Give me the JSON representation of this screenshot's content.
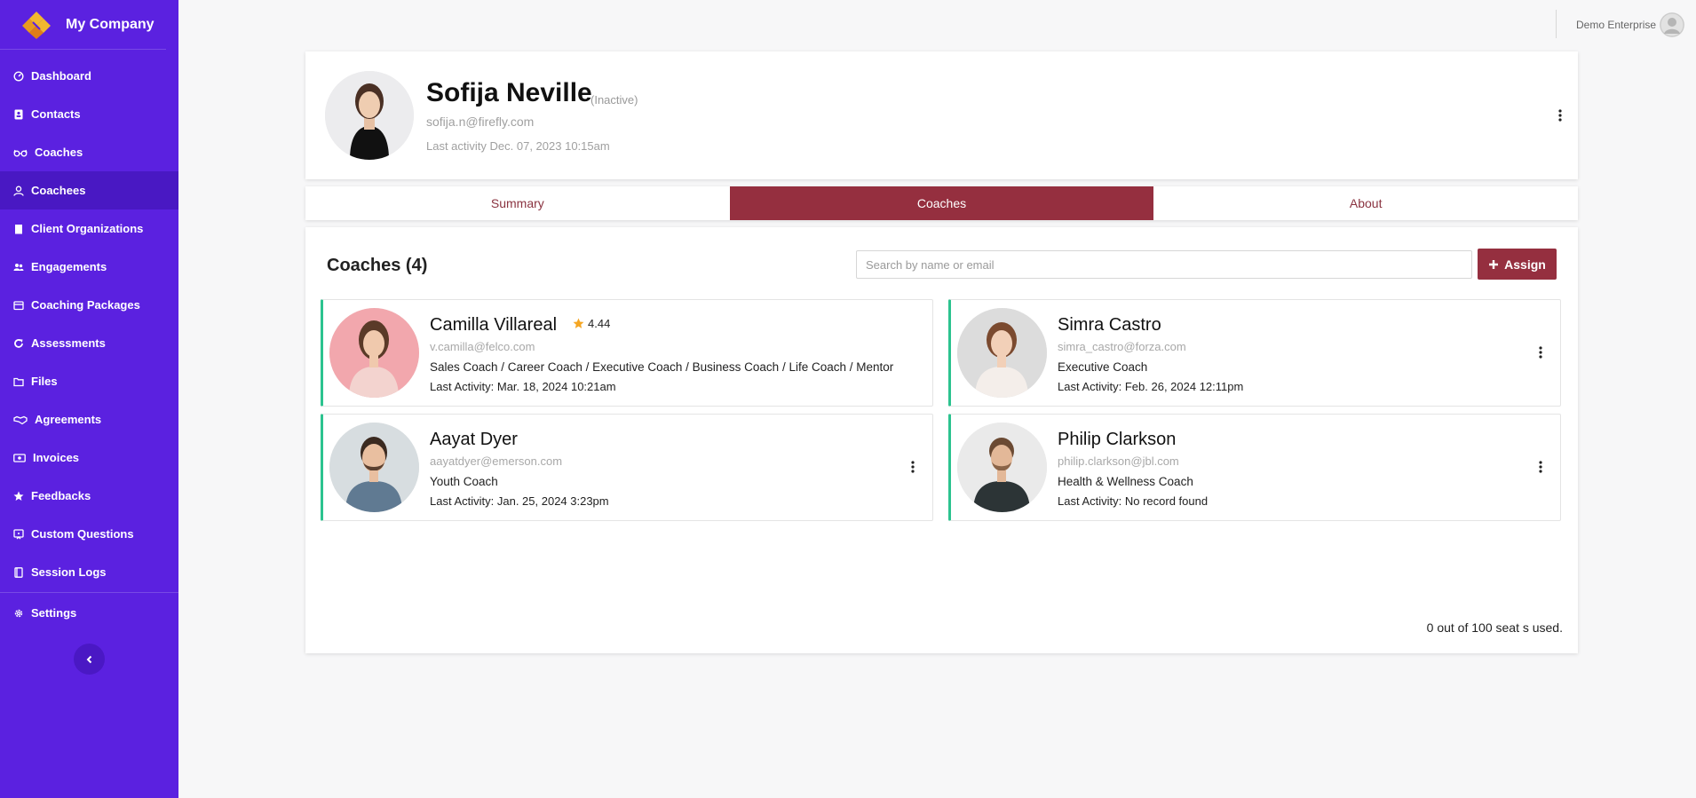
{
  "brand": {
    "name": "My Company",
    "accent": "#5b21e0"
  },
  "sidebar": {
    "items": [
      {
        "label": "Dashboard",
        "icon": "dashboard-icon"
      },
      {
        "label": "Contacts",
        "icon": "contacts-icon"
      },
      {
        "label": "Coaches",
        "icon": "glasses-icon"
      },
      {
        "label": "Coachees",
        "icon": "user-icon",
        "active": true
      },
      {
        "label": "Client Organizations",
        "icon": "building-icon"
      },
      {
        "label": "Engagements",
        "icon": "users-icon"
      },
      {
        "label": "Coaching Packages",
        "icon": "package-icon"
      },
      {
        "label": "Assessments",
        "icon": "refresh-icon"
      },
      {
        "label": "Files",
        "icon": "folder-icon"
      },
      {
        "label": "Agreements",
        "icon": "handshake-icon"
      },
      {
        "label": "Invoices",
        "icon": "money-icon"
      },
      {
        "label": "Feedbacks",
        "icon": "star-icon"
      },
      {
        "label": "Custom Questions",
        "icon": "question-book-icon"
      },
      {
        "label": "Session Logs",
        "icon": "book-icon"
      },
      {
        "label": "Settings",
        "icon": "gear-icon"
      }
    ]
  },
  "header": {
    "user_name": "Demo Enterprise"
  },
  "profile": {
    "name": "Sofija Neville",
    "status": "(Inactive)",
    "email": "sofija.n@firefly.com",
    "last_activity": "Last activity Dec. 07, 2023 10:15am"
  },
  "tabs": [
    {
      "label": "Summary"
    },
    {
      "label": "Coaches",
      "active": true
    },
    {
      "label": "About"
    }
  ],
  "coaches_panel": {
    "title": "Coaches (4)",
    "search_placeholder": "Search by name or email",
    "assign_label": "Assign",
    "seats_text": "0 out of 100 seat s used."
  },
  "coaches": [
    {
      "name": "Camilla Villareal",
      "rating": "4.44",
      "email": "v.camilla@felco.com",
      "role": "Sales Coach / Career Coach / Executive Coach / Business Coach / Life Coach / Mentor",
      "last_activity": "Last Activity: Mar. 18, 2024 10:21am"
    },
    {
      "name": "Simra Castro",
      "email": "simra_castro@forza.com",
      "role": "Executive Coach",
      "last_activity": "Last Activity: Feb. 26, 2024 12:11pm"
    },
    {
      "name": "Aayat Dyer",
      "email": "aayatdyer@emerson.com",
      "role": "Youth Coach",
      "last_activity": "Last Activity: Jan. 25, 2024 3:23pm"
    },
    {
      "name": "Philip Clarkson",
      "email": "philip.clarkson@jbl.com",
      "role": "Health & Wellness Coach",
      "last_activity": "Last Activity: No record found"
    }
  ],
  "colors": {
    "primary_maroon": "#952f3f",
    "card_accent_green": "#2cc38f",
    "rating_star": "#f5a623"
  }
}
